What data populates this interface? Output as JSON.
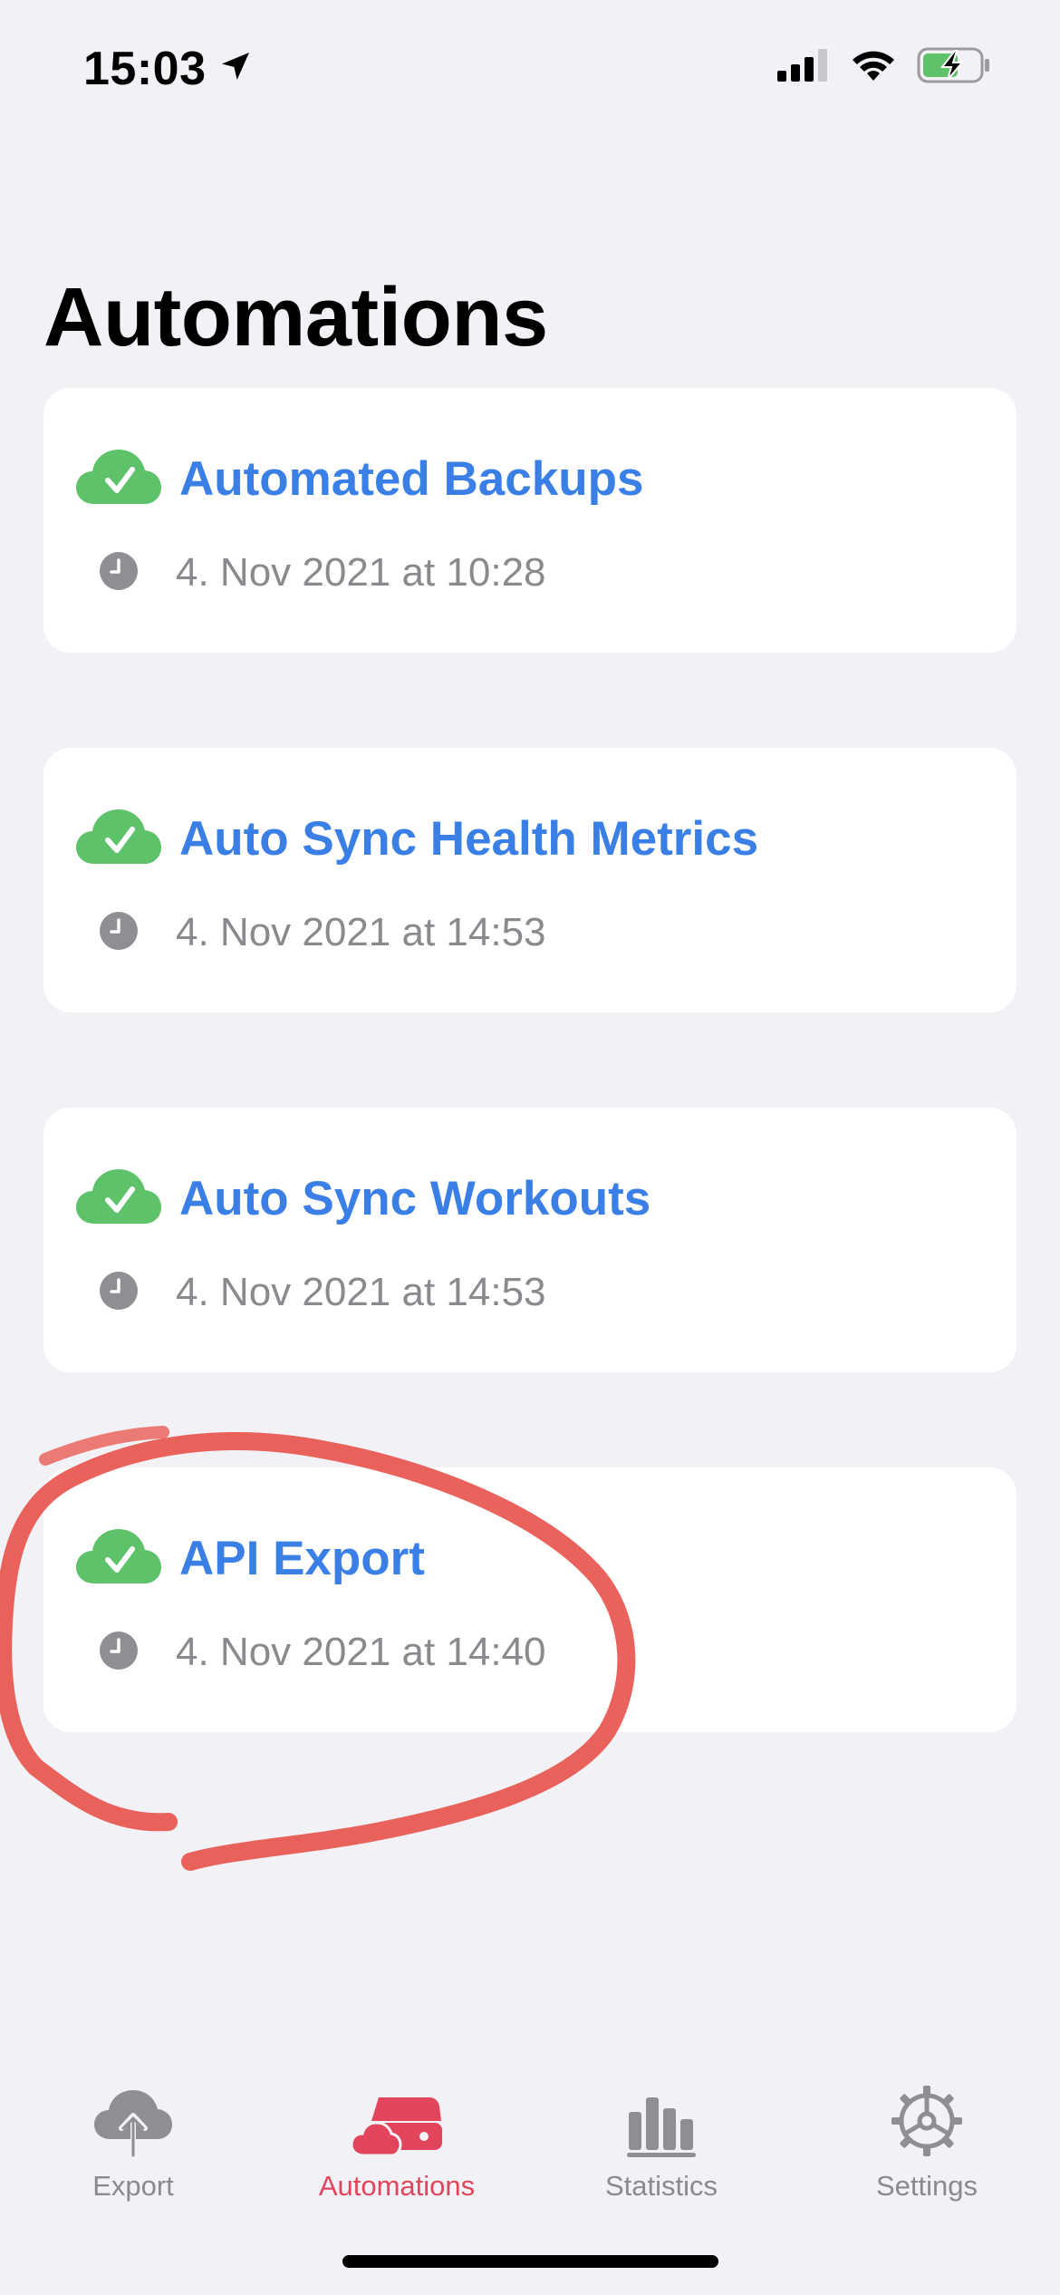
{
  "status_bar": {
    "time": "15:03",
    "icons": [
      "location-arrow-icon",
      "cellular-signal-icon",
      "wifi-icon",
      "battery-charging-icon"
    ]
  },
  "page": {
    "title": "Automations"
  },
  "automations": [
    {
      "title": "Automated Backups",
      "timestamp": "4. Nov 2021 at 10:28",
      "status_icon": "cloud-check-icon"
    },
    {
      "title": "Auto Sync Health Metrics",
      "timestamp": "4. Nov 2021 at 14:53",
      "status_icon": "cloud-check-icon"
    },
    {
      "title": "Auto Sync Workouts",
      "timestamp": "4. Nov 2021 at 14:53",
      "status_icon": "cloud-check-icon"
    },
    {
      "title": "API Export",
      "timestamp": "4. Nov 2021 at 14:40",
      "status_icon": "cloud-check-icon"
    }
  ],
  "tab_bar": {
    "tabs": [
      {
        "label": "Export",
        "icon": "cloud-upload-icon",
        "active": false
      },
      {
        "label": "Automations",
        "icon": "automations-icon",
        "active": true
      },
      {
        "label": "Statistics",
        "icon": "bar-chart-icon",
        "active": false
      },
      {
        "label": "Settings",
        "icon": "gear-icon",
        "active": false
      }
    ]
  },
  "colors": {
    "background": "#f2f1f6",
    "card": "#ffffff",
    "accent_blue": "#3a7fe6",
    "success_green": "#5ec26a",
    "active_tab_red": "#e2445c",
    "secondary_gray": "#8a8a8e",
    "annotation_red": "#e8514a"
  }
}
